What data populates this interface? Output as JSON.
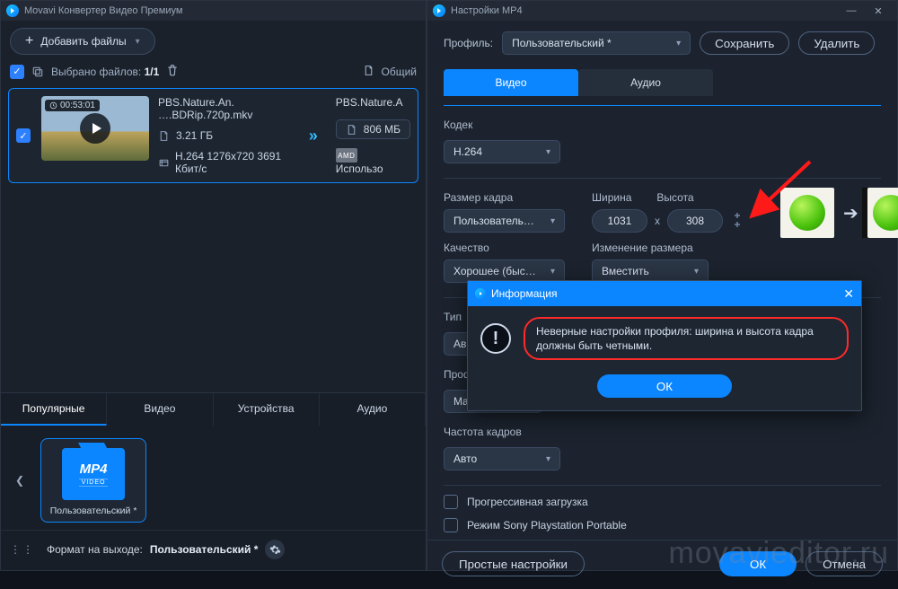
{
  "main": {
    "title": "Movavi Конвертер Видео Премиум",
    "addFiles": "Добавить файлы",
    "selectedLabel": "Выбрано файлов:",
    "selectedCount": "1/1",
    "totalLabel": "Общий",
    "file": {
      "duration": "00:53:01",
      "name": "PBS.Nature.An. ….BDRip.720p.mkv",
      "size": "3.21 ГБ",
      "codec": "H.264 1276x720 3691 Кбит/с",
      "outName": "PBS.Nature.A",
      "outSize": "806 МБ",
      "gpu": "AMD",
      "useGpu": "Использо"
    },
    "tabs": [
      "Популярные",
      "Видео",
      "Устройства",
      "Аудио"
    ],
    "preset": {
      "fmt": "MP4",
      "sub": "VIDEO",
      "label": "Пользовательский *"
    },
    "outFmtLabel": "Формат на выходе:",
    "outFmtValue": "Пользовательский *"
  },
  "settings": {
    "title": "Настройки MP4",
    "profileLabel": "Профиль:",
    "profileValue": "Пользовательский *",
    "save": "Сохранить",
    "delete": "Удалить",
    "tabVideo": "Видео",
    "tabAudio": "Аудио",
    "codecLabel": "Кодек",
    "codecValue": "H.264",
    "frameSizeLabel": "Размер кадра",
    "frameSizeValue": "Пользователь…",
    "qualityLabel": "Качество",
    "qualityValue": "Хорошее (быс…",
    "widthLabel": "Ширина",
    "heightLabel": "Высота",
    "width": "1031",
    "height": "308",
    "resizeLabel": "Изменение размера",
    "resizeValue": "Вместить",
    "typeLabel": "Тип",
    "typeValue": "Ав",
    "profLabel2": "Проф",
    "profValue2": "Ma",
    "fpsLabel": "Частота кадров",
    "fpsValue": "Авто",
    "progressive": "Прогрессивная загрузка",
    "psp": "Режим Sony Playstation Portable",
    "simple": "Простые настройки",
    "ok": "ОК",
    "cancel": "Отмена"
  },
  "popup": {
    "title": "Информация",
    "message": "Неверные настройки профиля: ширина и высота кадра должны быть четными.",
    "ok": "ОК"
  },
  "watermark": "movavieditor.ru"
}
